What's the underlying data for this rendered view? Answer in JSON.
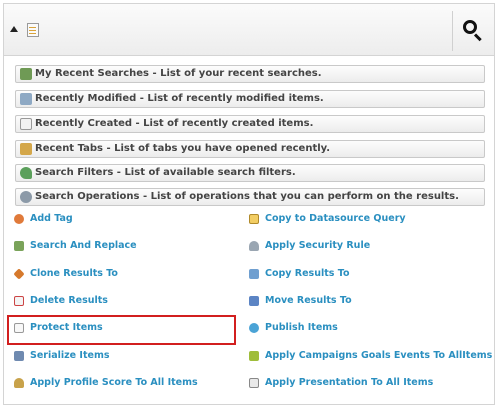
{
  "search": {
    "toggle_icon": "triangle-up-icon",
    "type_icon": "document-icon",
    "button_icon": "magnifier-icon"
  },
  "sections": [
    {
      "label": "My Recent Searches - List of your recent searches.",
      "icon": "recent-searches-icon"
    },
    {
      "label": "Recently Modified - List of recently modified items.",
      "icon": "recently-modified-icon"
    },
    {
      "label": "Recently Created - List of recently created items.",
      "icon": "recently-created-icon"
    },
    {
      "label": "Recent Tabs - List of tabs you have opened recently.",
      "icon": "recent-tabs-icon"
    },
    {
      "label": "Search Filters - List of available search filters.",
      "icon": "search-filters-icon"
    },
    {
      "label": "Search Operations - List of operations that you can perform on the results.",
      "icon": "search-operations-icon"
    }
  ],
  "operations": {
    "left": [
      {
        "label": "Add Tag",
        "icon": "tag-icon"
      },
      {
        "label": "Search And Replace",
        "icon": "search-replace-icon"
      },
      {
        "label": "Clone Results To",
        "icon": "clone-icon"
      },
      {
        "label": "Delete Results",
        "icon": "delete-icon"
      },
      {
        "label": "Protect Items",
        "icon": "protect-icon"
      },
      {
        "label": "Serialize Items",
        "icon": "serialize-icon"
      },
      {
        "label": "Apply Profile Score To All Items",
        "icon": "profile-score-icon"
      }
    ],
    "right": [
      {
        "label": "Copy to Datasource Query",
        "icon": "datasource-icon"
      },
      {
        "label": "Apply Security Rule",
        "icon": "security-rule-icon"
      },
      {
        "label": "Copy Results To",
        "icon": "copy-icon"
      },
      {
        "label": "Move Results To",
        "icon": "move-icon"
      },
      {
        "label": "Publish Items",
        "icon": "publish-icon"
      },
      {
        "label": "Apply Campaigns Goals Events To AllItems",
        "icon": "campaigns-icon"
      },
      {
        "label": "Apply Presentation To All Items",
        "icon": "presentation-icon"
      }
    ]
  },
  "colors": {
    "link": "#2a8fc0",
    "highlight": "#d21f1f",
    "section_text": "#444444"
  }
}
